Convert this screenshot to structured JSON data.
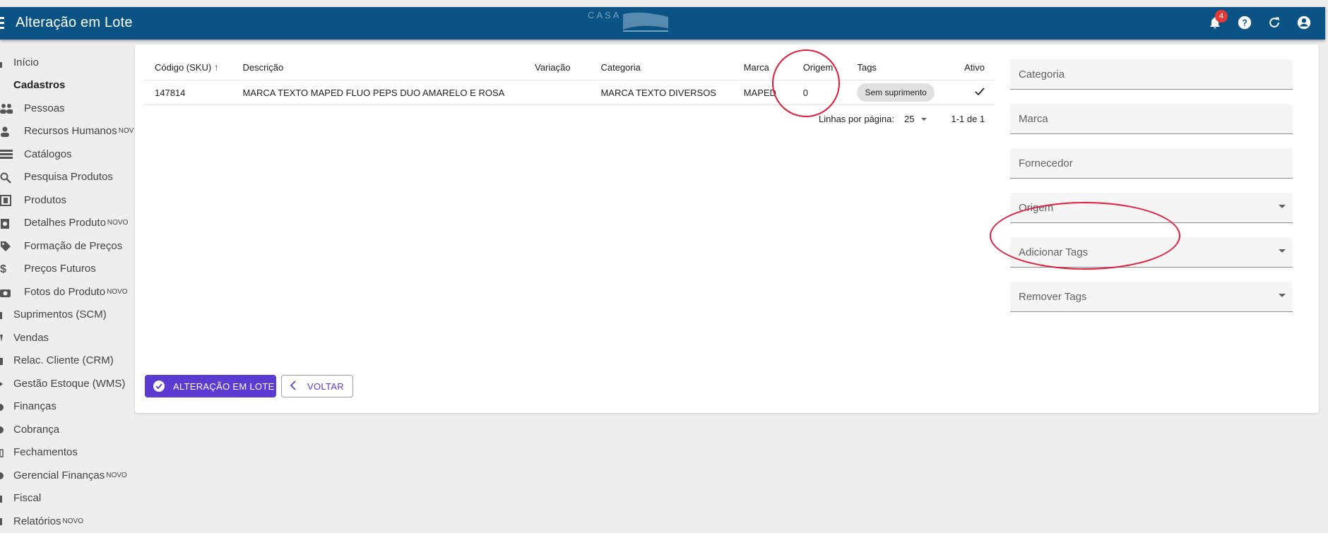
{
  "header": {
    "title": "Alteração em Lote",
    "notification_count": "4",
    "logo_text": "CASA"
  },
  "sidebar": {
    "items": [
      {
        "label": "Início",
        "new": ""
      },
      {
        "label": "Cadastros",
        "new": ""
      },
      {
        "label": "Pessoas",
        "new": ""
      },
      {
        "label": "Recursos Humanos",
        "new": "NOV"
      },
      {
        "label": "Catálogos",
        "new": ""
      },
      {
        "label": "Pesquisa Produtos",
        "new": ""
      },
      {
        "label": "Produtos",
        "new": ""
      },
      {
        "label": "Detalhes Produto",
        "new": "NOVO"
      },
      {
        "label": "Formação de Preços",
        "new": ""
      },
      {
        "label": "Preços Futuros",
        "new": ""
      },
      {
        "label": "Fotos do Produto",
        "new": "NOVO"
      },
      {
        "label": "Suprimentos (SCM)",
        "new": ""
      },
      {
        "label": "Vendas",
        "new": ""
      },
      {
        "label": "Relac. Cliente (CRM)",
        "new": ""
      },
      {
        "label": "Gestão Estoque (WMS)",
        "new": ""
      },
      {
        "label": "Finanças",
        "new": ""
      },
      {
        "label": "Cobrança",
        "new": ""
      },
      {
        "label": "Fechamentos",
        "new": ""
      },
      {
        "label": "Gerencial Finanças",
        "new": "NOVO"
      },
      {
        "label": "Fiscal",
        "new": ""
      },
      {
        "label": "Relatórios",
        "new": "NOVO"
      }
    ]
  },
  "table": {
    "columns": [
      "Código (SKU)",
      "Descrição",
      "Variação",
      "Categoria",
      "Marca",
      "Origem",
      "Tags",
      "Ativo"
    ],
    "rows": [
      {
        "sku": "147814",
        "descricao": "MARCA TEXTO MAPED FLUO PEPS DUO AMARELO E ROSA",
        "variacao": "",
        "categoria": "MARCA TEXTO DIVERSOS",
        "marca": "MAPED",
        "origem": "0",
        "tag": "Sem suprimento"
      }
    ],
    "pagination": {
      "rows_per_page_label": "Linhas por página:",
      "rows_per_page": "25",
      "range": "1-1 de 1"
    }
  },
  "form": {
    "categoria": "Categoria",
    "marca": "Marca",
    "fornecedor": "Fornecedor",
    "origem": "Origem",
    "adicionar_tags": "Adicionar Tags",
    "remover_tags": "Remover Tags"
  },
  "actions": {
    "batch_label": "ALTERAÇÃO EM LOTE",
    "back_label": "VOLTAR"
  },
  "colors": {
    "topbar": "#0b5384",
    "primary": "#5b3bd1",
    "highlight": "#e31a3a"
  }
}
